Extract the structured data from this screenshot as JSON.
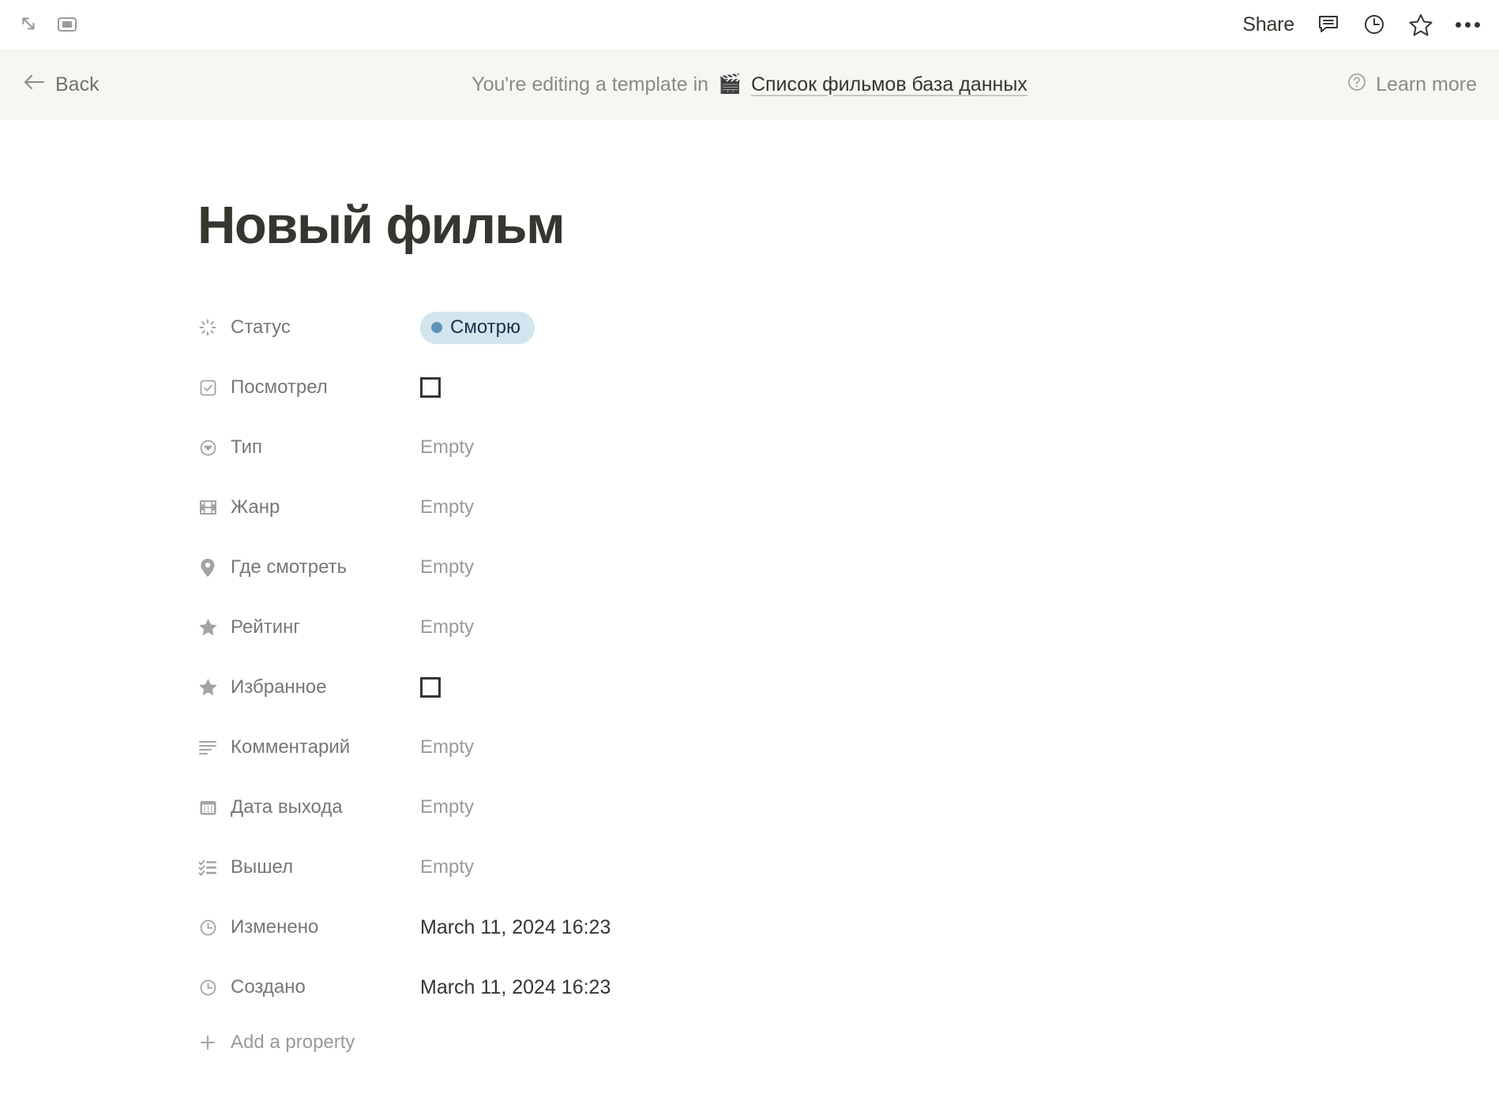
{
  "topbar": {
    "left_icons": [
      {
        "name": "expand-icon"
      },
      {
        "name": "sidebar-panel-icon"
      }
    ],
    "share_label": "Share",
    "right_icons": [
      {
        "name": "comment-icon"
      },
      {
        "name": "history-clock-icon"
      },
      {
        "name": "favorite-star-icon"
      },
      {
        "name": "more-options-icon"
      }
    ]
  },
  "banner": {
    "back_label": "Back",
    "message": "You're editing a template in",
    "database_emoji": "🎬",
    "database_name": "Список фильмов база данных",
    "learn_more_label": "Learn more",
    "background_color": "#f7f6f3"
  },
  "page": {
    "title": "Новый фильм",
    "add_property_label": "Add a property"
  },
  "properties": [
    {
      "icon": "status-spinner-icon",
      "label": "Статус",
      "value_type": "status",
      "value": "Смотрю",
      "pill_bg": "#d3e5ef",
      "pill_dot": "#5b93b8",
      "pill_text": "#183347"
    },
    {
      "icon": "checkbox-icon",
      "label": "Посмотрел",
      "value_type": "checkbox",
      "value": "unchecked"
    },
    {
      "icon": "select-chevron-icon",
      "label": "Тип",
      "value_type": "empty",
      "value": "Empty"
    },
    {
      "icon": "filmstrip-icon",
      "label": "Жанр",
      "value_type": "empty",
      "value": "Empty"
    },
    {
      "icon": "location-pin-icon",
      "label": "Где смотреть",
      "value_type": "empty",
      "value": "Empty"
    },
    {
      "icon": "star-icon",
      "label": "Рейтинг",
      "value_type": "empty",
      "value": "Empty"
    },
    {
      "icon": "star-icon",
      "label": "Избранное",
      "value_type": "checkbox",
      "value": "unchecked"
    },
    {
      "icon": "text-lines-icon",
      "label": "Комментарий",
      "value_type": "empty",
      "value": "Empty"
    },
    {
      "icon": "calendar-icon",
      "label": "Дата выхода",
      "value_type": "empty",
      "value": "Empty"
    },
    {
      "icon": "checklist-icon",
      "label": "Вышел",
      "value_type": "empty",
      "value": "Empty"
    },
    {
      "icon": "clock-icon",
      "label": "Изменено",
      "value_type": "text",
      "value": "March 11, 2024 16:23"
    },
    {
      "icon": "clock-icon",
      "label": "Создано",
      "value_type": "text",
      "value": "March 11, 2024 16:23"
    }
  ]
}
